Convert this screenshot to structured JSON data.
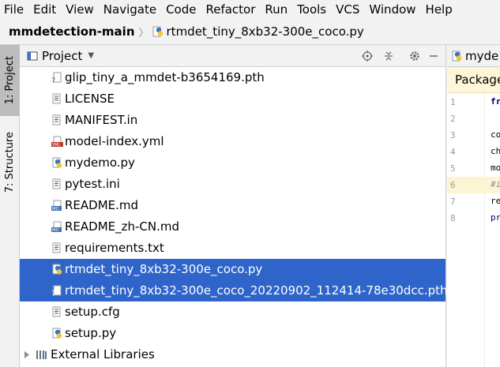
{
  "menu": [
    "File",
    "Edit",
    "View",
    "Navigate",
    "Code",
    "Refactor",
    "Run",
    "Tools",
    "VCS",
    "Window",
    "Help"
  ],
  "breadcrumb": {
    "project": "mmdetection-main",
    "file": "rtmdet_tiny_8xb32-300e_coco.py"
  },
  "toolstrip": {
    "project_tab": "1: Project",
    "structure_tab": "7: Structure"
  },
  "project_panel": {
    "title": "Project",
    "files": [
      {
        "name": "glip_tiny_a_mmdet-b3654169.pth",
        "icon": "pth-file-icon",
        "selected": false
      },
      {
        "name": "LICENSE",
        "icon": "text-file-icon",
        "selected": false
      },
      {
        "name": "MANIFEST.in",
        "icon": "text-file-icon",
        "selected": false
      },
      {
        "name": "model-index.yml",
        "icon": "yml-file-icon",
        "selected": false
      },
      {
        "name": "mydemo.py",
        "icon": "python-file-icon",
        "selected": false
      },
      {
        "name": "pytest.ini",
        "icon": "text-file-icon",
        "selected": false
      },
      {
        "name": "README.md",
        "icon": "markdown-file-icon",
        "selected": false
      },
      {
        "name": "README_zh-CN.md",
        "icon": "markdown-file-icon",
        "selected": false
      },
      {
        "name": "requirements.txt",
        "icon": "text-file-icon",
        "selected": false
      },
      {
        "name": "rtmdet_tiny_8xb32-300e_coco.py",
        "icon": "python-file-icon",
        "selected": true
      },
      {
        "name": "rtmdet_tiny_8xb32-300e_coco_20220902_112414-78e30dcc.pth",
        "icon": "pth-file-icon",
        "selected": true
      },
      {
        "name": "setup.cfg",
        "icon": "text-file-icon",
        "selected": false
      },
      {
        "name": "setup.py",
        "icon": "python-file-icon",
        "selected": false
      }
    ],
    "external_libraries": "External Libraries"
  },
  "editor": {
    "tab_label": "myde",
    "banner": "Package",
    "lines": [
      {
        "num": "1",
        "code": "fr",
        "kind": "kw"
      },
      {
        "num": "2",
        "code": "",
        "kind": ""
      },
      {
        "num": "3",
        "code": "co",
        "kind": ""
      },
      {
        "num": "4",
        "code": "ch",
        "kind": ""
      },
      {
        "num": "5",
        "code": "mo",
        "kind": ""
      },
      {
        "num": "6",
        "code": "#i",
        "kind": "cm"
      },
      {
        "num": "7",
        "code": "re",
        "kind": ""
      },
      {
        "num": "8",
        "code": "pr",
        "kind": "fn"
      }
    ],
    "highlighted_line": "6"
  },
  "colors": {
    "selection": "#2f65ca",
    "python_yellow": "#f3c333",
    "python_blue": "#3d73b8",
    "yml_red": "#c0392b",
    "md_blue": "#3d73b8"
  }
}
